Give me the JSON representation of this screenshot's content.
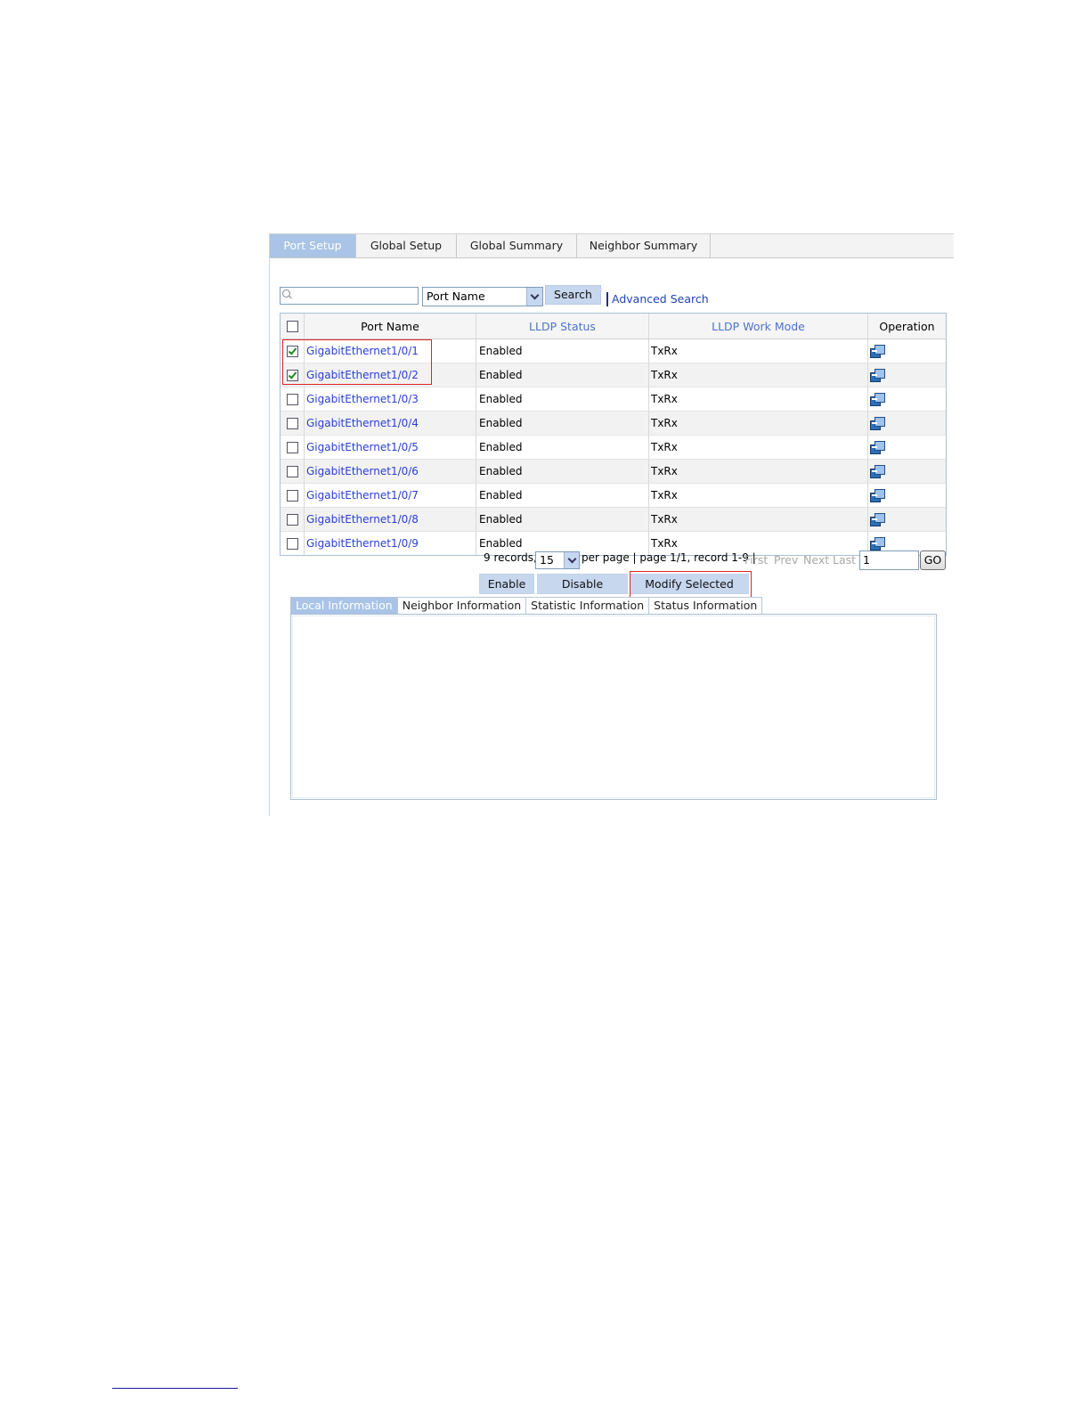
{
  "top_tabs": [
    "Port Setup",
    "Global Setup",
    "Global Summary",
    "Neighbor Summary"
  ],
  "search": {
    "input_value": "",
    "field_select": "Port Name",
    "button": "Search",
    "advanced_link": "Advanced Search"
  },
  "table": {
    "headers": [
      "Port Name",
      "LLDP Status",
      "LLDP Work Mode",
      "Operation"
    ],
    "rows": [
      {
        "port": "GigabitEthernet1/0/1",
        "status": "Enabled",
        "mode": "TxRx",
        "checked": true
      },
      {
        "port": "GigabitEthernet1/0/2",
        "status": "Enabled",
        "mode": "TxRx",
        "checked": true
      },
      {
        "port": "GigabitEthernet1/0/3",
        "status": "Enabled",
        "mode": "TxRx",
        "checked": false
      },
      {
        "port": "GigabitEthernet1/0/4",
        "status": "Enabled",
        "mode": "TxRx",
        "checked": false
      },
      {
        "port": "GigabitEthernet1/0/5",
        "status": "Enabled",
        "mode": "TxRx",
        "checked": false
      },
      {
        "port": "GigabitEthernet1/0/6",
        "status": "Enabled",
        "mode": "TxRx",
        "checked": false
      },
      {
        "port": "GigabitEthernet1/0/7",
        "status": "Enabled",
        "mode": "TxRx",
        "checked": false
      },
      {
        "port": "GigabitEthernet1/0/8",
        "status": "Enabled",
        "mode": "TxRx",
        "checked": false
      },
      {
        "port": "GigabitEthernet1/0/9",
        "status": "Enabled",
        "mode": "TxRx",
        "checked": false
      }
    ],
    "operation_icon": "edit-icon"
  },
  "pager": {
    "records": "9 records,",
    "per_page_value": "15",
    "per_page_text": "per page | page 1/1, record 1-9 |",
    "first": "First",
    "prev": "Prev",
    "next": "Next",
    "last": "Last",
    "goto_value": "1",
    "go": "GO"
  },
  "actions": {
    "enable": "Enable",
    "disable": "Disable",
    "modify": "Modify Selected"
  },
  "info_tabs": [
    "Local Information",
    "Neighbor Information",
    "Statistic Information",
    "Status Information"
  ],
  "colors": {
    "tab_active": "#a9c4e6",
    "button_bg": "#c6d7ee",
    "link": "#2a3fd0",
    "highlight": "#e02424"
  }
}
